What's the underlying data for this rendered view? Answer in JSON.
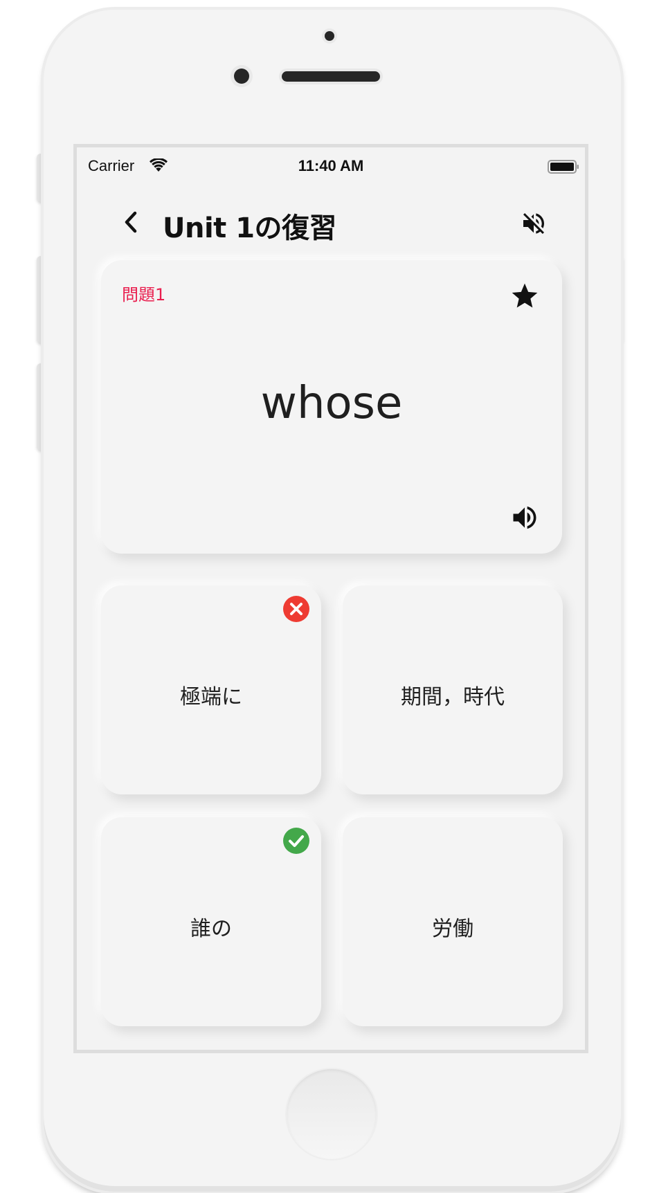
{
  "status_bar": {
    "carrier": "Carrier",
    "time": "11:40 AM"
  },
  "nav": {
    "title": "Unit 1の復習",
    "back_icon": "chevron-left-icon",
    "sound_icon": "volume-off-icon"
  },
  "question": {
    "number_label": "問題1",
    "word": "whose",
    "favorite_icon": "star-icon",
    "audio_icon": "volume-up-icon"
  },
  "answers": [
    {
      "label": "極端に",
      "result": "incorrect"
    },
    {
      "label": "期間，時代",
      "result": ""
    },
    {
      "label": "誰の",
      "result": "correct"
    },
    {
      "label": "労働",
      "result": ""
    }
  ],
  "colors": {
    "question_number": "#e91e4e",
    "incorrect": "#ee3b32",
    "correct": "#43a84a",
    "screen_background": "#f3f3f3"
  }
}
